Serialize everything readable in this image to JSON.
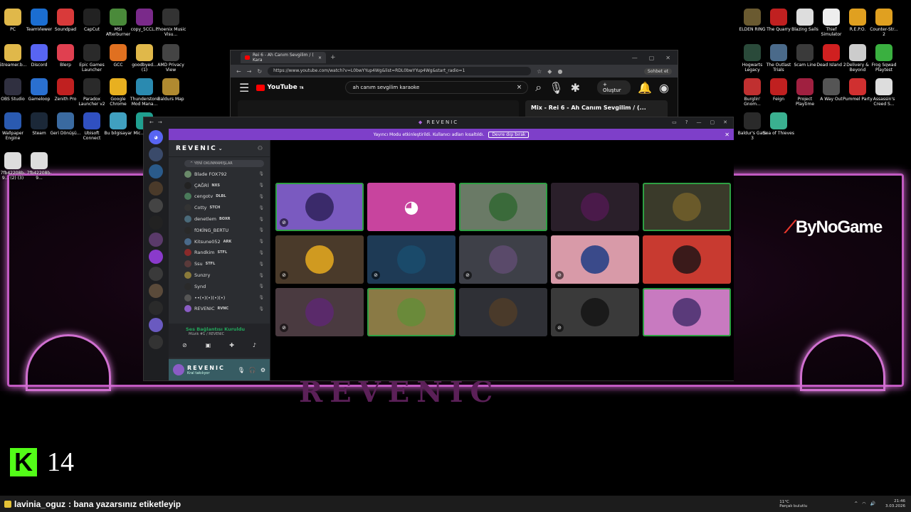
{
  "desktop": {
    "left_icons": [
      {
        "label": "PC",
        "color": "#e0b84a"
      },
      {
        "label": "TeamViewer",
        "color": "#1b6ed1"
      },
      {
        "label": "Soundpad",
        "color": "#d93a3a"
      },
      {
        "label": "CapCut",
        "color": "#222222"
      },
      {
        "label": "MSI Afterburner",
        "color": "#4a8a3a"
      },
      {
        "label": "copy_5CCL...",
        "color": "#7a2a8a"
      },
      {
        "label": "Phoenix Music Visu...",
        "color": "#333333"
      },
      {
        "label": "Streamer.b...",
        "color": "#e0b84a"
      },
      {
        "label": "Discord",
        "color": "#5865f2"
      },
      {
        "label": "Blerp",
        "color": "#e04050"
      },
      {
        "label": "Epic Games Launcher",
        "color": "#2a2a2a"
      },
      {
        "label": "GCC",
        "color": "#e07020"
      },
      {
        "label": "goodbyed... (1)",
        "color": "#e0b84a"
      },
      {
        "label": "AMD Privacy View",
        "color": "#444444"
      },
      {
        "label": "OBS Studio",
        "color": "#303040"
      },
      {
        "label": "Gameloop",
        "color": "#2a70d0"
      },
      {
        "label": "Zenith Pro",
        "color": "#c02020"
      },
      {
        "label": "Paradox Launcher v2",
        "color": "#2a2a2a"
      },
      {
        "label": "Google Chrome",
        "color": "#e8b020"
      },
      {
        "label": "Thunderstore Mod Mana...",
        "color": "#2a8ab0"
      },
      {
        "label": "Baldurs Map",
        "color": "#b08a30"
      },
      {
        "label": "Wallpaper Engine",
        "color": "#2a5ab0"
      },
      {
        "label": "Steam",
        "color": "#1b2838"
      },
      {
        "label": "Geri Dönüşü...",
        "color": "#3a6aa0"
      },
      {
        "label": "Ubisoft Connect",
        "color": "#3050c0"
      },
      {
        "label": "Bu bilgisayar",
        "color": "#40a0c0"
      },
      {
        "label": "Mic... Ed...",
        "color": "#20a090"
      },
      {
        "label": "7fb42208b-9... (2) (3)",
        "color": "#dddddd"
      },
      {
        "label": "7fb42208b-9...",
        "color": "#dddddd"
      }
    ],
    "right_icons": [
      {
        "label": "ELDEN RING",
        "color": "#6a5a30"
      },
      {
        "label": "The Quarry",
        "color": "#c02020"
      },
      {
        "label": "Blazing Sails",
        "color": "#dddddd"
      },
      {
        "label": "Thief Simulator",
        "color": "#eeeeee"
      },
      {
        "label": "R.E.P.O.",
        "color": "#e0a020"
      },
      {
        "label": "Counter-Str... 2",
        "color": "#e0a020"
      },
      {
        "label": "Hogwarts Legacy",
        "color": "#2a4a3a"
      },
      {
        "label": "The Outlast Trials",
        "color": "#4a6a8a"
      },
      {
        "label": "Scam Line",
        "color": "#3a3a3a"
      },
      {
        "label": "Dead Island 2",
        "color": "#d02020"
      },
      {
        "label": "Delivery & Beyond",
        "color": "#cccccc"
      },
      {
        "label": "Frog Sqwad Playtest",
        "color": "#3ab040"
      },
      {
        "label": "Burglin' Gnom...",
        "color": "#c03030"
      },
      {
        "label": "Feign",
        "color": "#c02020"
      },
      {
        "label": "Project Playtime",
        "color": "#a02040"
      },
      {
        "label": "A Way Out",
        "color": "#555555"
      },
      {
        "label": "Pummel Party",
        "color": "#d03030"
      },
      {
        "label": "Assassin's Creed S...",
        "color": "#dddddd"
      },
      {
        "label": "Baldur's Gate 3",
        "color": "#2a2a2a"
      },
      {
        "label": "Sea of Thieves",
        "color": "#3ab090"
      }
    ]
  },
  "browser": {
    "tab_title": "Rei 6 - Ah Canım Sevgilim / ( Kara",
    "new_tab": "+",
    "url": "https://www.youtube.com/watch?v=L0bwYYup4Wg&list=RDL0bwYYup4Wg&start_radio=1",
    "chat_label": "Sohbet et",
    "yt_logo": "YouTube",
    "yt_region": "TR",
    "search_value": "ah canım sevgilim karaoke",
    "create_label": "Oluştur",
    "mix_title": "Mix - Rei 6 - Ah Canım Sevgilim / (..."
  },
  "discord": {
    "window_title": "REVENIC",
    "banner_text": "Yayıncı Modu etkinleştirildi. Kullanıcı adları kısaltıldı.",
    "banner_button": "Devre dışı bırak",
    "server_name": "REVENIC",
    "new_unreads": "YENİ OKUNMAMIŞLAR",
    "members": [
      {
        "name": "Blade FOX792",
        "tag": "",
        "color": "#6a8a6a"
      },
      {
        "name": "ÇAĞRİ",
        "tag": "NXS",
        "color": "#222222"
      },
      {
        "name": "cengotv",
        "tag": "DLBL",
        "color": "#4a7a5a"
      },
      {
        "name": "Cotty",
        "tag": "STCH",
        "color": "#333333"
      },
      {
        "name": "denetlem",
        "tag": "BOXR",
        "color": "#4a6a7a"
      },
      {
        "name": "fOKİNG_BERTU",
        "tag": "",
        "color": "#2a2a2a"
      },
      {
        "name": "Kitsune052",
        "tag": "ARK",
        "color": "#4a6a8a"
      },
      {
        "name": "Randkim",
        "tag": "STFL",
        "color": "#8a2a2a"
      },
      {
        "name": "Ssu",
        "tag": "STFL",
        "color": "#5a3a3a"
      },
      {
        "name": "Sunzry",
        "tag": "",
        "color": "#8a7a3a"
      },
      {
        "name": "Synd",
        "tag": "",
        "color": "#2a2a2a"
      },
      {
        "name": "••(•)(•)(•)(•)",
        "tag": "",
        "color": "#555555"
      },
      {
        "name": "REVENIC",
        "tag": "RVNC",
        "color": "#8a5cc5"
      }
    ],
    "voice_status": "Ses Bağlantısı Kuruldu",
    "voice_channel": "Müzik #1 / REVENIC",
    "user_name": "REVENIC",
    "user_status": "Kral takılıyor",
    "tiles": [
      {
        "bg": "#7a5ac0",
        "avatar": "#3a2a6a",
        "speaking": true,
        "muted": true
      },
      {
        "bg": "#c8449e",
        "avatar": "#c8449e",
        "speaking": false,
        "muted": false
      },
      {
        "bg": "#6a7a66",
        "avatar": "#3a6a3a",
        "speaking": true,
        "muted": false
      },
      {
        "bg": "#2a1f2a",
        "avatar": "#4a1a4a",
        "speaking": false,
        "muted": false
      },
      {
        "bg": "#3a3a2a",
        "avatar": "#6a5a2a",
        "speaking": true,
        "muted": false
      },
      {
        "bg": "#4a3a2a",
        "avatar": "#d09a20",
        "speaking": false,
        "muted": true
      },
      {
        "bg": "#1e3a55",
        "avatar": "#1a4a6a",
        "speaking": false,
        "muted": true
      },
      {
        "bg": "#3e4048",
        "avatar": "#5a4a6a",
        "speaking": false,
        "muted": true
      },
      {
        "bg": "#d89aa8",
        "avatar": "#3a4a8a",
        "speaking": false,
        "muted": true
      },
      {
        "bg": "#c83a30",
        "avatar": "#3a1a1a",
        "speaking": false,
        "muted": false
      },
      {
        "bg": "#4a3a40",
        "avatar": "#5a2a6a",
        "speaking": false,
        "muted": true
      },
      {
        "bg": "#8a7a45",
        "avatar": "#6a8a3a",
        "speaking": true,
        "muted": false
      },
      {
        "bg": "#2f3036",
        "avatar": "#4a3a2a",
        "speaking": false,
        "muted": false
      },
      {
        "bg": "#3a3a3a",
        "avatar": "#1a1a1a",
        "speaking": false,
        "muted": true
      },
      {
        "bg": "#c87ac0",
        "avatar": "#5a3a7a",
        "speaking": true,
        "muted": false
      }
    ]
  },
  "overlay": {
    "brand_name": "ByNoGame",
    "wallpaper_text": "REVENIC",
    "kick_letter": "K",
    "viewer_count": "14"
  },
  "taskbar": {
    "chat_user": "lavinia_oguz",
    "chat_message": ": bana yazarsınız etiketleyip",
    "weather_temp": "11°C",
    "weather_desc": "Parçalı bulutlu",
    "time": "21:46",
    "date": "3.03.2026"
  }
}
